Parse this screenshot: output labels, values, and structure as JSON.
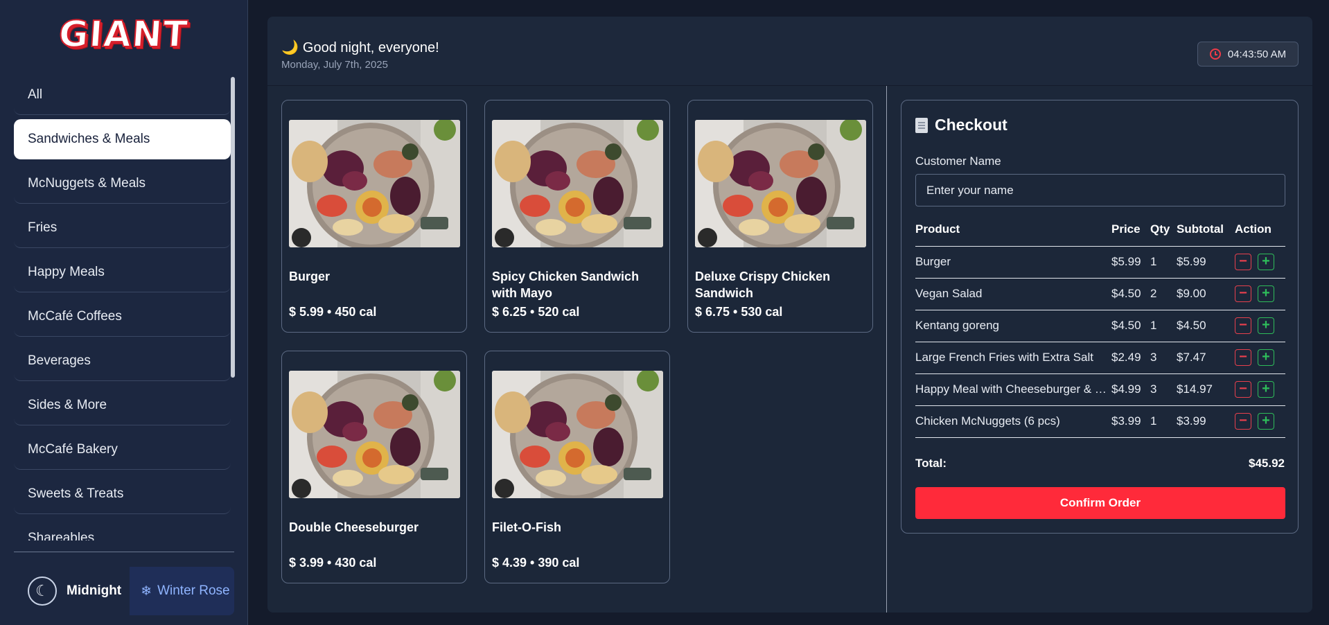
{
  "brand": {
    "logo_text": "GIANT"
  },
  "sidebar": {
    "categories": [
      {
        "label": "All"
      },
      {
        "label": "Sandwiches & Meals"
      },
      {
        "label": "McNuggets & Meals"
      },
      {
        "label": "Fries"
      },
      {
        "label": "Happy Meals"
      },
      {
        "label": "McCafé Coffees"
      },
      {
        "label": "Beverages"
      },
      {
        "label": "Sides & More"
      },
      {
        "label": "McCafé Bakery"
      },
      {
        "label": "Sweets & Treats"
      },
      {
        "label": "Shareables"
      }
    ],
    "active_category": "Sandwiches & Meals",
    "themes": {
      "midnight": "Midnight",
      "winter": "Winter Rose"
    }
  },
  "header": {
    "greeting": "Good night, everyone!",
    "date": "Monday, July 7th, 2025",
    "time": "04:43:50 AM"
  },
  "products": [
    {
      "name": "Burger",
      "meta": "$ 5.99 • 450 cal"
    },
    {
      "name": "Spicy Chicken Sandwich with Mayo",
      "meta": "$ 6.25 • 520 cal"
    },
    {
      "name": "Deluxe Crispy Chicken Sandwich",
      "meta": "$ 6.75 • 530 cal"
    },
    {
      "name": "Double Cheeseburger",
      "meta": "$ 3.99 • 430 cal"
    },
    {
      "name": "Filet-O-Fish",
      "meta": "$ 4.39 • 390 cal"
    }
  ],
  "checkout": {
    "title": "Checkout",
    "customer_label": "Customer Name",
    "customer_placeholder": "Enter your name",
    "headers": {
      "product": "Product",
      "price": "Price",
      "qty": "Qty",
      "subtotal": "Subtotal",
      "action": "Action"
    },
    "items": [
      {
        "product": "Burger",
        "price": "$5.99",
        "qty": "1",
        "subtotal": "$5.99"
      },
      {
        "product": "Vegan Salad",
        "price": "$4.50",
        "qty": "2",
        "subtotal": "$9.00"
      },
      {
        "product": "Kentang goreng",
        "price": "$4.50",
        "qty": "1",
        "subtotal": "$4.50"
      },
      {
        "product": "Large French Fries with Extra Salt",
        "price": "$2.49",
        "qty": "3",
        "subtotal": "$7.47"
      },
      {
        "product": "Happy Meal with Cheeseburger & …",
        "price": "$4.99",
        "qty": "3",
        "subtotal": "$14.97"
      },
      {
        "product": "Chicken McNuggets (6 pcs)",
        "price": "$3.99",
        "qty": "1",
        "subtotal": "$3.99"
      }
    ],
    "total_label": "Total:",
    "total_value": "$45.92",
    "confirm_label": "Confirm Order"
  },
  "colors": {
    "accent": "#ff2a3a",
    "panel": "#1c2739",
    "sidebar": "#1c2740",
    "plus": "#2ebd5a",
    "minus": "#e8404d"
  }
}
